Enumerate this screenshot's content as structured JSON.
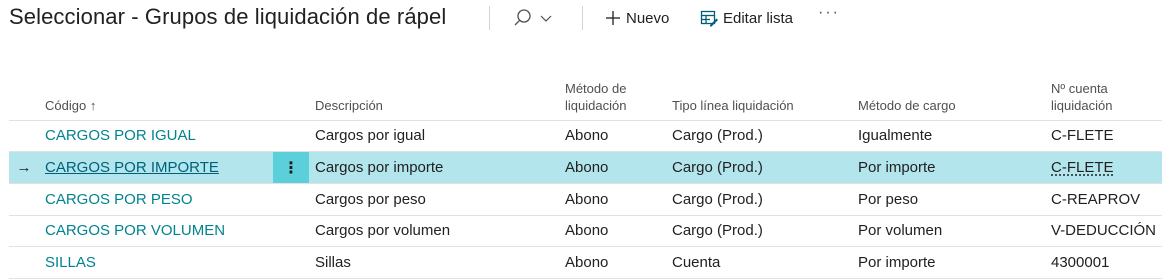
{
  "header": {
    "title": "Seleccionar - Grupos de liquidación de rápel",
    "new_label": "Nuevo",
    "edit_list_label": "Editar lista",
    "more_label": "···"
  },
  "table": {
    "columns": {
      "codigo": "Código",
      "sort_indicator": "↑",
      "descripcion": "Descripción",
      "metodo_liquidacion_1": "Método de",
      "metodo_liquidacion_2": "liquidación",
      "tipo_linea": "Tipo línea liquidación",
      "metodo_cargo": "Método de cargo",
      "cuenta_1": "Nº cuenta",
      "cuenta_2": "liquidación"
    },
    "selected_marker": "→",
    "row_menu": "⋮",
    "rows": [
      {
        "codigo": "CARGOS POR IGUAL",
        "descripcion": "Cargos por igual",
        "metodo": "Abono",
        "tipo": "Cargo (Prod.)",
        "cargo": "Igualmente",
        "cuenta": "C-FLETE"
      },
      {
        "codigo": "CARGOS POR IMPORTE",
        "descripcion": "Cargos por importe",
        "metodo": "Abono",
        "tipo": "Cargo (Prod.)",
        "cargo": "Por importe",
        "cuenta": "C-FLETE"
      },
      {
        "codigo": "CARGOS POR PESO",
        "descripcion": "Cargos por peso",
        "metodo": "Abono",
        "tipo": "Cargo (Prod.)",
        "cargo": "Por peso",
        "cuenta": "C-REAPROV"
      },
      {
        "codigo": "CARGOS POR VOLUMEN",
        "descripcion": "Cargos por volumen",
        "metodo": "Abono",
        "tipo": "Cargo (Prod.)",
        "cargo": "Por volumen",
        "cuenta": "V-DEDUCCIÓN"
      },
      {
        "codigo": "SILLAS",
        "descripcion": "Sillas",
        "metodo": "Abono",
        "tipo": "Cuenta",
        "cargo": "Por importe",
        "cuenta": "4300001"
      }
    ]
  },
  "colors": {
    "accent": "#00838f",
    "selected_row": "#b3e6ec",
    "row_menu": "#5bd0db"
  }
}
